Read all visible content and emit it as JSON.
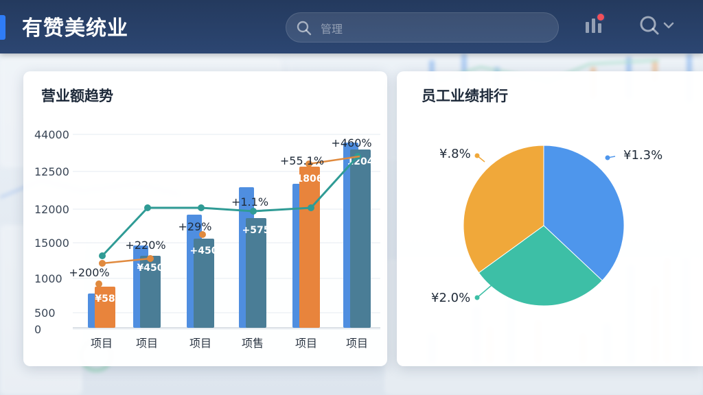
{
  "app": {
    "title": "有赞美统业"
  },
  "header": {
    "search_placeholder": "管理",
    "icons": [
      "search-icon",
      "bar-chart-icon",
      "notification-badge",
      "magnifier-icon",
      "chevron-down-icon"
    ]
  },
  "colors": {
    "header_bg": "#243a5e",
    "accent": "#2f7cf6",
    "bar_blue": "#4f8ee0",
    "bar_teal": "#4a7d96",
    "bar_orange": "#e8843c",
    "line_teal": "#2f9b95",
    "line_orange": "#e08a3e",
    "pie_orange": "#f0a83a",
    "pie_blue": "#4e96ec",
    "pie_teal": "#3dbfa6"
  },
  "revenue_card": {
    "title": "营业额趋势"
  },
  "ranking_card": {
    "title": "员工业绩排行"
  },
  "chart_data": [
    {
      "type": "bar",
      "title": "营业额趋势",
      "y_ticks": [
        "44000",
        "12500",
        "12000",
        "15000",
        "1000",
        "500",
        "0"
      ],
      "categories": [
        "项目",
        "项目",
        "项目",
        "项售",
        "项目",
        "项目"
      ],
      "series": [
        {
          "values": [
            1.0,
            2.4,
            3.3,
            4.1,
            4.2,
            5.4
          ]
        },
        {
          "values": [
            1.2,
            2.1,
            2.6,
            3.2,
            4.7,
            5.2
          ]
        }
      ],
      "bar_labels": [
        "¥58",
        "¥450",
        "+450",
        "+575",
        "1806",
        "1204"
      ],
      "line_values": [
        2.1,
        3.5,
        3.5,
        3.4,
        3.5,
        5.0
      ],
      "secondary_line_values": [
        2.0,
        2.1
      ],
      "percent_labels": [
        "+200%",
        "+220%",
        "+29%",
        "+1.1%",
        "+55.1%",
        "+460%"
      ]
    },
    {
      "type": "pie",
      "title": "员工业绩排行",
      "slices": [
        {
          "label": "¥1.3%",
          "value": 37,
          "color": "#4e96ec"
        },
        {
          "label": "¥2.0%",
          "value": 28,
          "color": "#3dbfa6"
        },
        {
          "label": "¥.8%",
          "value": 35,
          "color": "#f0a83a"
        }
      ]
    }
  ]
}
